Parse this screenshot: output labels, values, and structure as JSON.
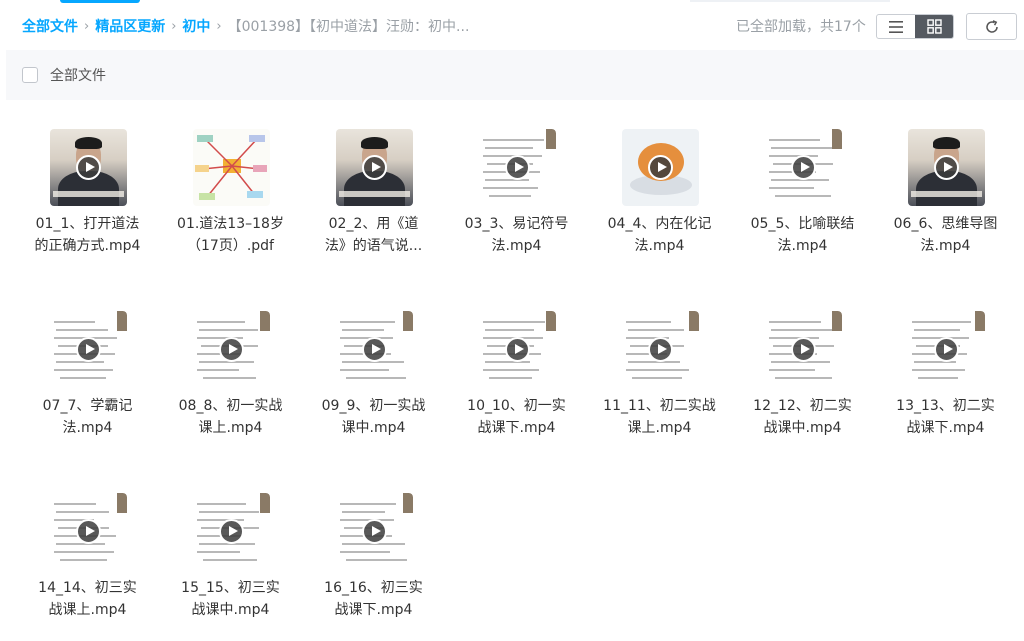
{
  "breadcrumb": {
    "items": [
      "全部文件",
      "精品区更新",
      "初中"
    ],
    "current": "【001398】【初中道法】汪勋：初中..."
  },
  "status": {
    "loaded_text": "已全部加载，共17个"
  },
  "icons": {
    "list": "list-icon",
    "grid": "grid-icon",
    "refresh": "refresh-icon",
    "play": "play-icon"
  },
  "colors": {
    "accent": "#06a7ff",
    "active_toggle": "#555a61",
    "header_bg": "#f7f8fa"
  },
  "header": {
    "label": "全部文件"
  },
  "files": [
    {
      "line1": "01_1、打开道法",
      "line2": "的正确方式.mp4",
      "kind": "person"
    },
    {
      "line1": "01.道法13–18岁",
      "line2": "（17页）.pdf",
      "kind": "mind"
    },
    {
      "line1": "02_2、用《道",
      "line2": "法》的语气说...",
      "kind": "person"
    },
    {
      "line1": "03_3、易记符号",
      "line2": "法.mp4",
      "kind": "doc"
    },
    {
      "line1": "04_4、内在化记",
      "line2": "法.mp4",
      "kind": "photo"
    },
    {
      "line1": "05_5、比喻联结",
      "line2": "法.mp4",
      "kind": "doc"
    },
    {
      "line1": "06_6、思维导图",
      "line2": "法.mp4",
      "kind": "person"
    },
    {
      "line1": "07_7、学霸记",
      "line2": "法.mp4",
      "kind": "doc"
    },
    {
      "line1": "08_8、初一实战",
      "line2": "课上.mp4",
      "kind": "doc"
    },
    {
      "line1": "09_9、初一实战",
      "line2": "课中.mp4",
      "kind": "doc"
    },
    {
      "line1": "10_10、初一实",
      "line2": "战课下.mp4",
      "kind": "doc"
    },
    {
      "line1": "11_11、初二实战",
      "line2": "课上.mp4",
      "kind": "doc"
    },
    {
      "line1": "12_12、初二实",
      "line2": "战课中.mp4",
      "kind": "doc"
    },
    {
      "line1": "13_13、初二实",
      "line2": "战课下.mp4",
      "kind": "doc"
    },
    {
      "line1": "14_14、初三实",
      "line2": "战课上.mp4",
      "kind": "doc"
    },
    {
      "line1": "15_15、初三实",
      "line2": "战课中.mp4",
      "kind": "doc"
    },
    {
      "line1": "16_16、初三实",
      "line2": "战课下.mp4",
      "kind": "doc"
    }
  ]
}
